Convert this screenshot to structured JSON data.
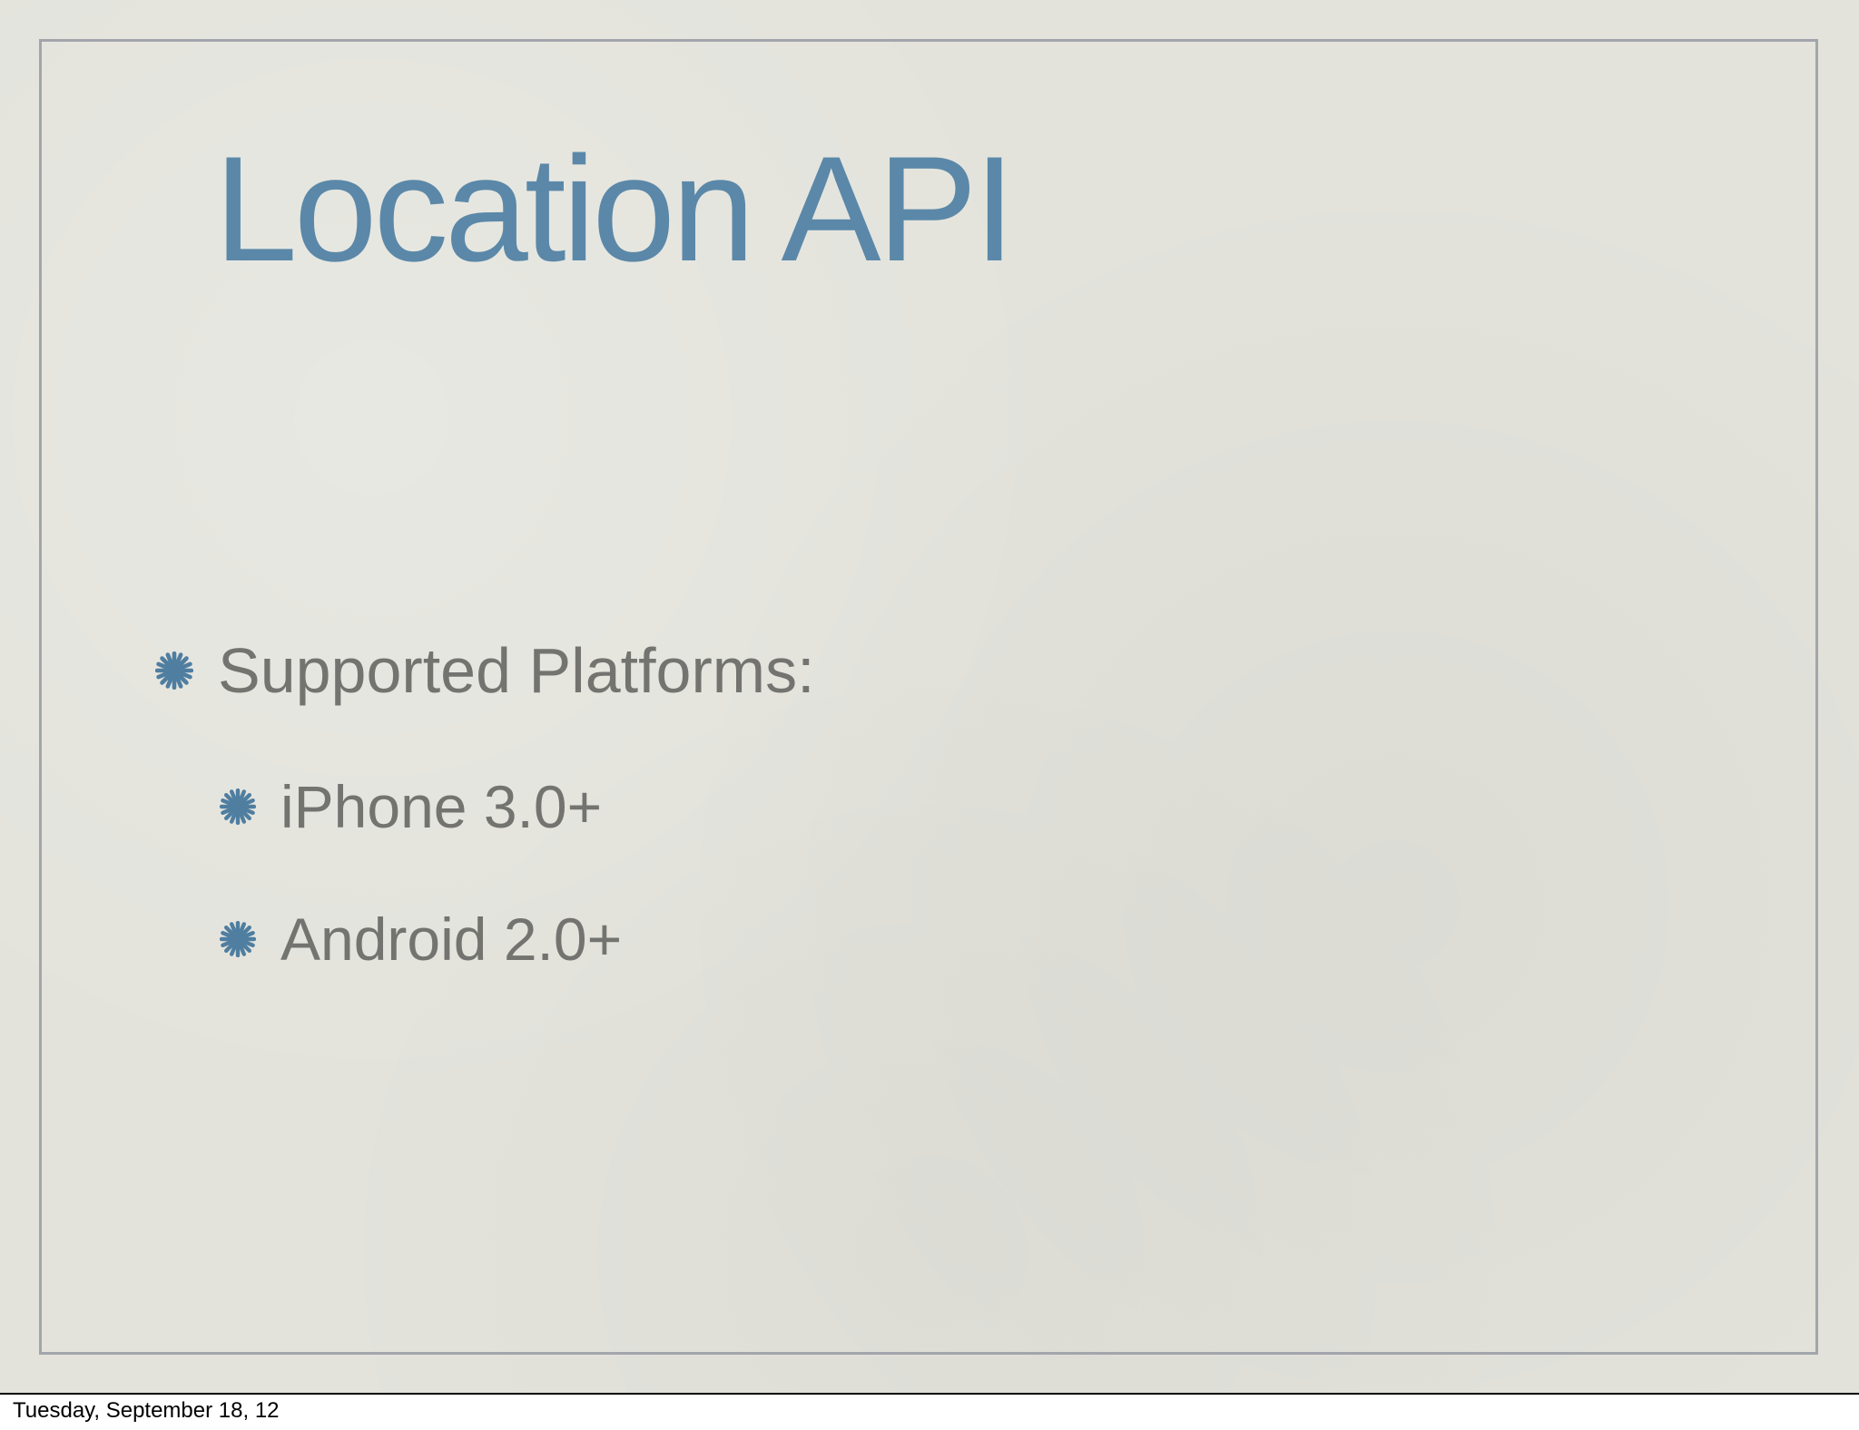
{
  "slide": {
    "title": "Location API",
    "bullets": [
      {
        "level": 1,
        "text": "Supported Platforms:",
        "icon": "asterisk-bullet-icon"
      },
      {
        "level": 2,
        "text": "iPhone 3.0+",
        "icon": "asterisk-bullet-icon"
      },
      {
        "level": 2,
        "text": "Android 2.0+",
        "icon": "asterisk-bullet-icon"
      }
    ]
  },
  "footer": {
    "date": "Tuesday, September 18, 12"
  },
  "colors": {
    "background": "#e3e3dc",
    "frame": "#a3a5ac",
    "title": "#5b88a8",
    "bullet_text": "#737370",
    "bullet_icon": "#4f7ea0"
  }
}
